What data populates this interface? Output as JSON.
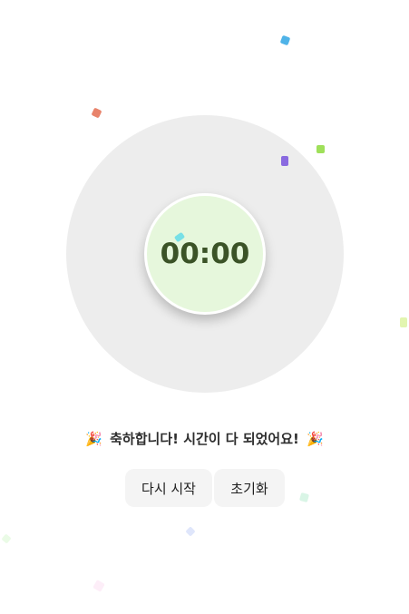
{
  "timer": {
    "display": "00:00"
  },
  "message": {
    "left_emoji": "🎉",
    "text": "축하합니다! 시간이 다 되었어요!",
    "right_emoji": "🎉"
  },
  "buttons": {
    "restart_label": "다시 시작",
    "reset_label": "초기화"
  },
  "colors": {
    "dial_outer": "#ededed",
    "dial_inner": "#e6f7dc",
    "time_text": "#3b5327",
    "button_bg": "#f4f4f4"
  }
}
